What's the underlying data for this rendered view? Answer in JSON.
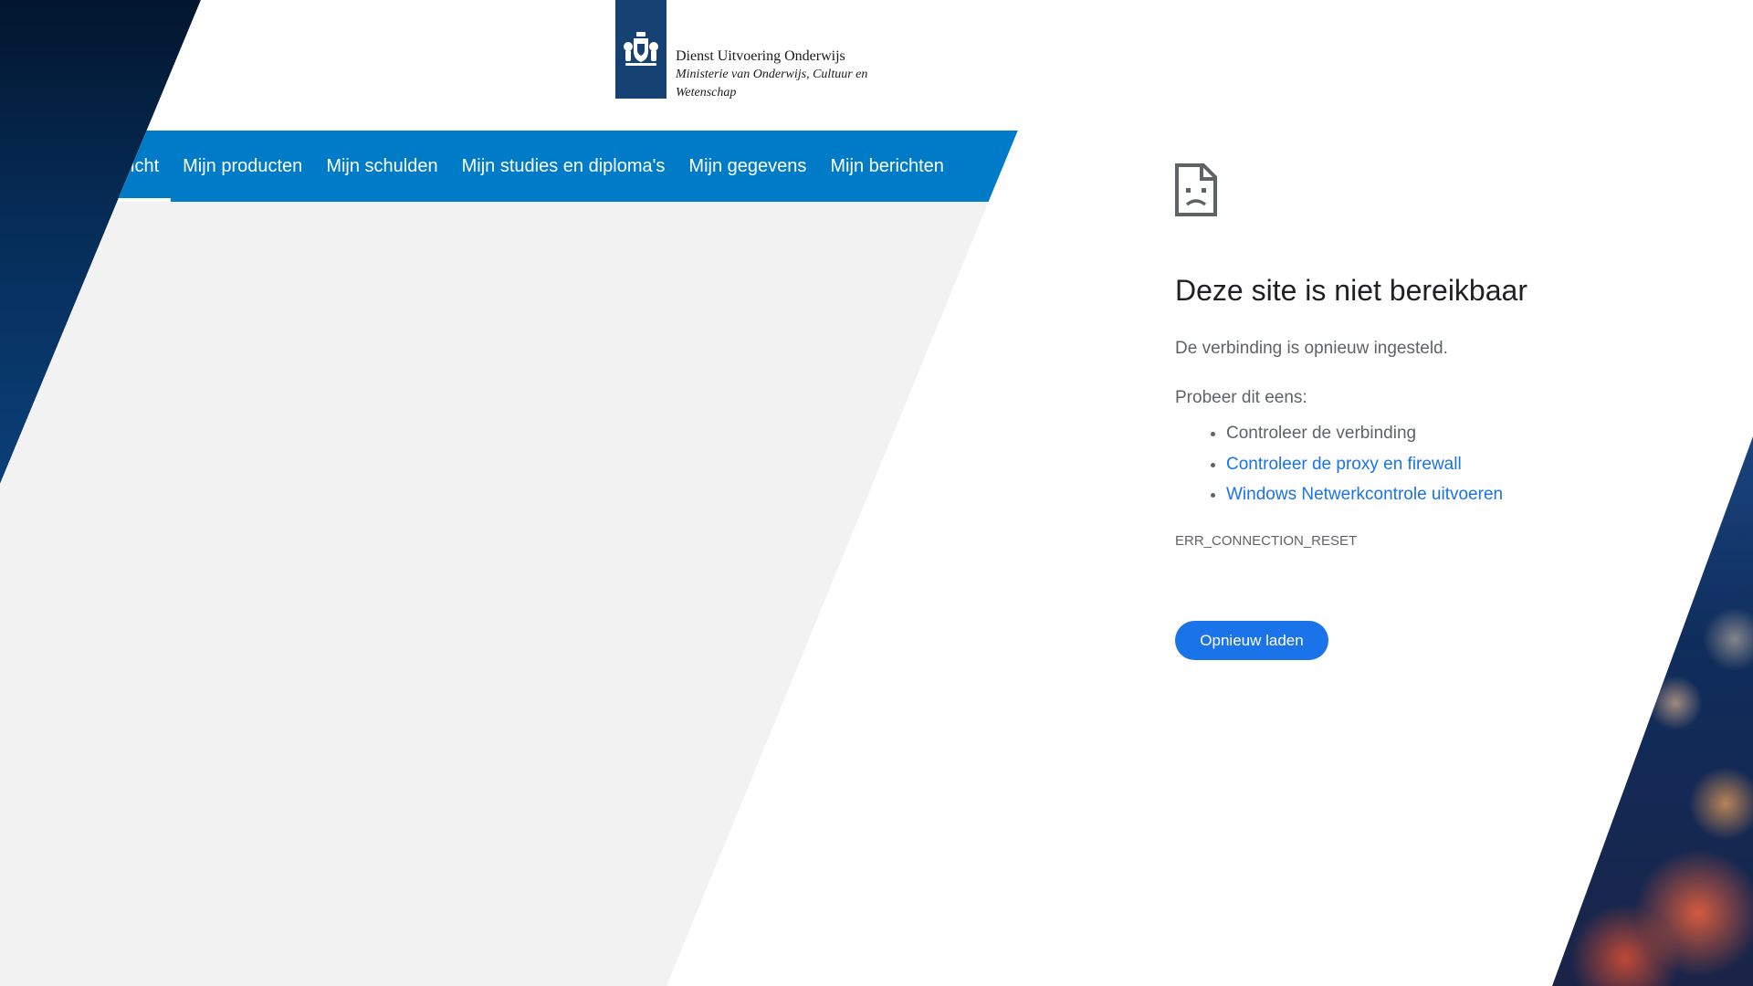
{
  "site": {
    "logo": {
      "org": "Dienst Uitvoering Onderwijs",
      "ministry_line1": "Ministerie van Onderwijs, Cultuur en",
      "ministry_line2": "Wetenschap"
    },
    "nav": [
      {
        "label": "zicht",
        "active": true
      },
      {
        "label": "Mijn producten",
        "active": false
      },
      {
        "label": "Mijn schulden",
        "active": false
      },
      {
        "label": "Mijn studies en diploma's",
        "active": false
      },
      {
        "label": "Mijn gegevens",
        "active": false
      },
      {
        "label": "Mijn berichten",
        "active": false
      }
    ],
    "colors": {
      "nav": "#007bc7",
      "logo_bar": "#154273",
      "content_bg": "#f2f2f2"
    }
  },
  "error": {
    "icon": "sad-page-icon",
    "title": "Deze site is niet bereikbaar",
    "subtitle": "De verbinding is opnieuw ingesteld.",
    "try_label": "Probeer dit eens:",
    "suggestions": [
      {
        "text": "Controleer de verbinding",
        "link": false
      },
      {
        "text": "Controleer de proxy en firewall",
        "link": true
      },
      {
        "text": "Windows Netwerkcontrole uitvoeren",
        "link": true
      }
    ],
    "code": "ERR_CONNECTION_RESET",
    "reload_label": "Opnieuw laden",
    "colors": {
      "accent": "#1a73e8",
      "title": "#202124",
      "text": "#5f6368"
    }
  }
}
